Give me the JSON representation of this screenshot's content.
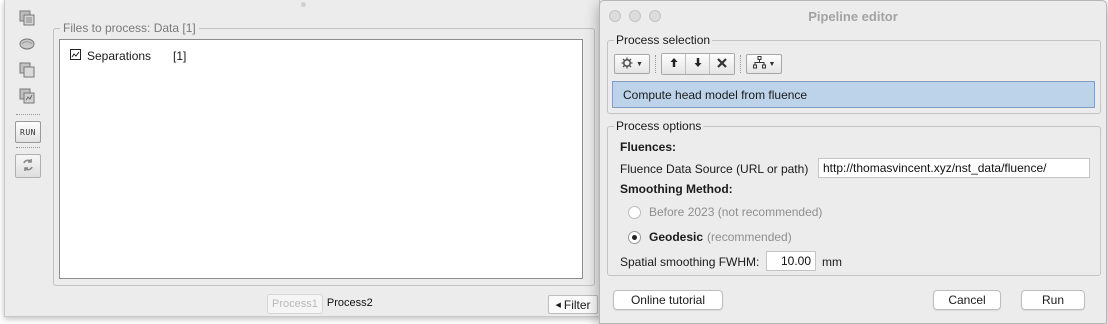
{
  "left_window": {
    "files_legend": "Files to process: Data [1]",
    "tree": {
      "node_label": "Separations",
      "node_count": "[1]"
    },
    "toolbar": {
      "run_label": "RUN"
    },
    "tabs": [
      "Process1",
      "Process2"
    ],
    "filter_label": "Filter"
  },
  "pipeline_editor": {
    "title": "Pipeline editor",
    "process_selection": {
      "legend": "Process selection",
      "selected_process": "Compute head model from fluence"
    },
    "process_options": {
      "legend": "Process options",
      "fluences_header": "Fluences:",
      "fluence_source_label": "Fluence Data Source (URL or path)",
      "fluence_source_value": "http://thomasvincent.xyz/nst_data/fluence/",
      "smoothing_header": "Smoothing Method:",
      "option_before": "Before 2023 (not recommended)",
      "option_geodesic": "Geodesic",
      "option_geodesic_hint": "(recommended)",
      "fwhm_label": "Spatial smoothing FWHM:",
      "fwhm_value": "10.00",
      "fwhm_unit": "mm"
    },
    "buttons": {
      "tutorial": "Online tutorial",
      "cancel": "Cancel",
      "run": "Run"
    }
  },
  "colors": {
    "selection_bg": "#bcd3ea",
    "window_bg": "#ececec"
  }
}
